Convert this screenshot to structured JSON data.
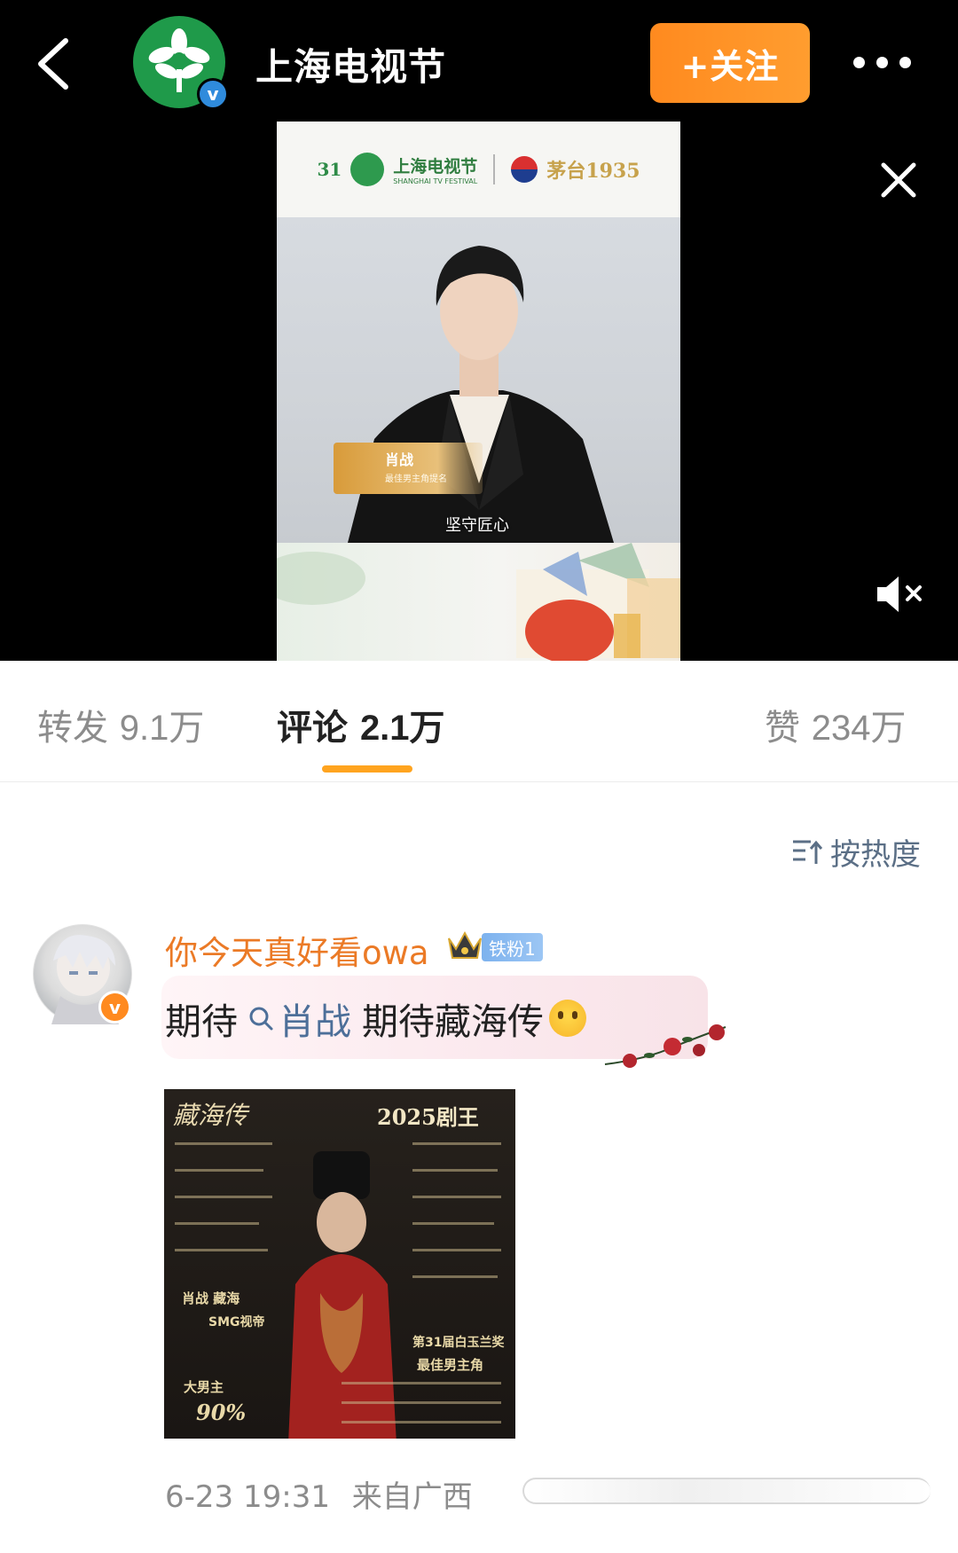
{
  "header": {
    "account_name": "上海电视节",
    "follow_label": "+关注"
  },
  "video": {
    "banner_festival_cn": "上海电视节",
    "banner_festival_en": "SHANGHAI TV FESTIVAL",
    "banner_number": "31",
    "banner_sponsor": "茅台1935",
    "name_card_title": "肖战",
    "name_card_sub": "最佳男主角提名",
    "subtitle": "坚守匠心"
  },
  "tabs": [
    {
      "label": "转发",
      "count": "9.1万"
    },
    {
      "label": "评论",
      "count": "2.1万"
    },
    {
      "label": "赞",
      "count": "234万"
    }
  ],
  "sort": {
    "label": "按热度"
  },
  "comment": {
    "username": "你今天真好看owa",
    "fan_badge": "铁粉1",
    "text_before": "期待",
    "link_text": "肖战",
    "text_after": "期待藏海传",
    "timestamp": "6-23 19:31",
    "location": "来自广西"
  },
  "poster": {
    "title_left": "藏海传",
    "title_right": "2025剧王",
    "names": "肖战 藏海",
    "smg": "SMG视帝",
    "award_center": "第31届白玉兰奖",
    "award_center_sub": "最佳男主角",
    "percent_label": "大男主",
    "percent_value": "90%"
  }
}
